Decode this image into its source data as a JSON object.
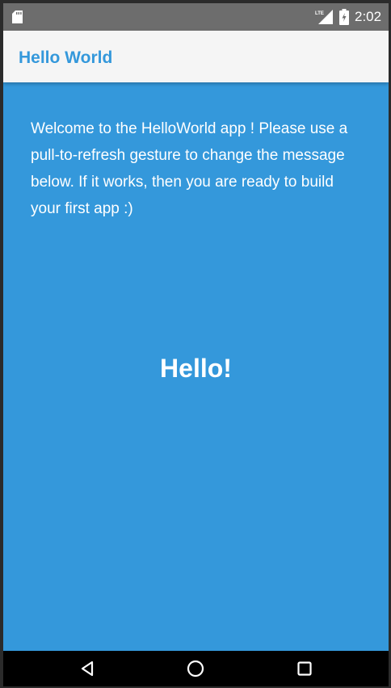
{
  "status_bar": {
    "time": "2:02",
    "network_label": "LTE",
    "icons": [
      "sd-card-icon",
      "lte-signal-icon",
      "battery-charging-icon"
    ]
  },
  "app_bar": {
    "title": "Hello World"
  },
  "content": {
    "welcome_message": "Welcome to the HelloWorld app ! Please use a pull-to-refresh gesture to change the message below. If it works, then you are ready to build your first app :)",
    "greeting": "Hello!"
  },
  "nav_bar": {
    "icons": [
      "back-icon",
      "home-icon",
      "recents-icon"
    ]
  },
  "colors": {
    "primary": "#3498db",
    "app_bar_background": "#f5f5f5",
    "status_bar_background": "#6d6d6d",
    "nav_bar_background": "#000000",
    "text_on_primary": "#ffffff"
  }
}
